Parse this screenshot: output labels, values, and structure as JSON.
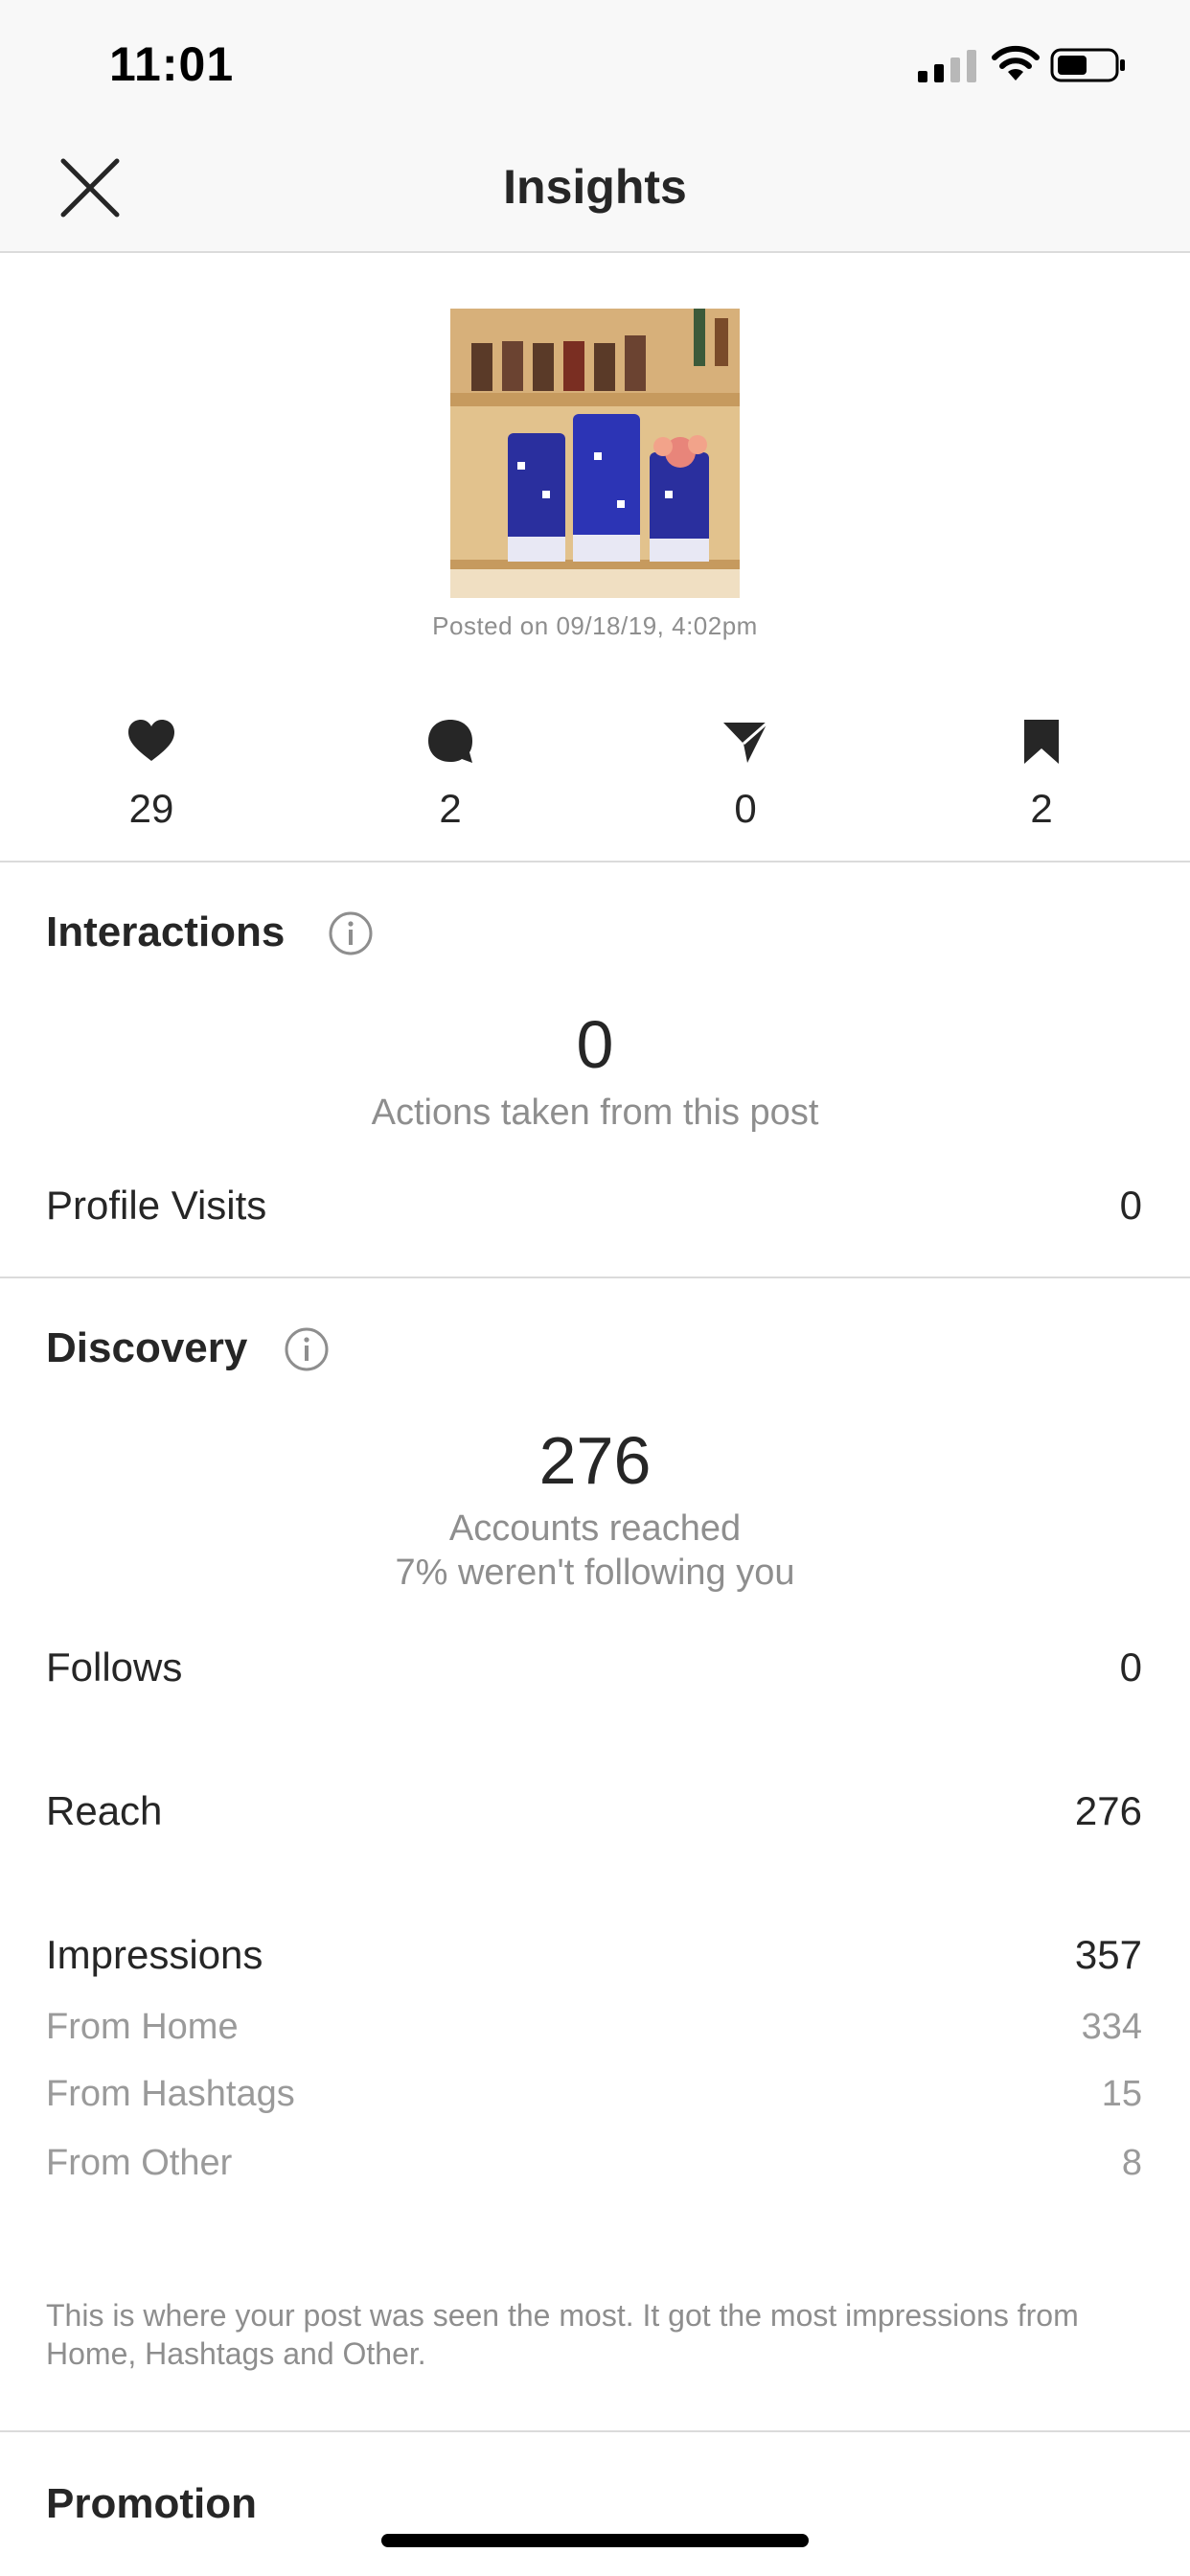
{
  "status_bar": {
    "time": "11:01"
  },
  "nav": {
    "title": "Insights"
  },
  "post": {
    "posted_text": "Posted on 09/18/19, 4:02pm",
    "stats": [
      {
        "icon": "heart-icon",
        "value": "29"
      },
      {
        "icon": "comment-icon",
        "value": "2"
      },
      {
        "icon": "send-icon",
        "value": "0"
      },
      {
        "icon": "bookmark-icon",
        "value": "2"
      }
    ]
  },
  "interactions": {
    "title": "Interactions",
    "total": "0",
    "subtitle": "Actions taken from this post",
    "rows": [
      {
        "label": "Profile Visits",
        "value": "0"
      }
    ]
  },
  "discovery": {
    "title": "Discovery",
    "total": "276",
    "subtitle": "Accounts reached",
    "subtitle2": "7% weren't following you",
    "rows": [
      {
        "label": "Follows",
        "value": "0"
      },
      {
        "label": "Reach",
        "value": "276"
      },
      {
        "label": "Impressions",
        "value": "357"
      }
    ],
    "impression_breakdown": [
      {
        "label": "From Home",
        "value": "334"
      },
      {
        "label": "From Hashtags",
        "value": "15"
      },
      {
        "label": "From Other",
        "value": "8"
      }
    ],
    "note": "This is where your post was seen the most. It got the most impressions from Home, Hashtags and Other."
  },
  "promotion": {
    "title": "Promotion"
  },
  "colors": {
    "text": "#262626",
    "muted": "#8e8e8e",
    "divider": "#dbdbdb",
    "header_bg": "#f8f8f8"
  }
}
